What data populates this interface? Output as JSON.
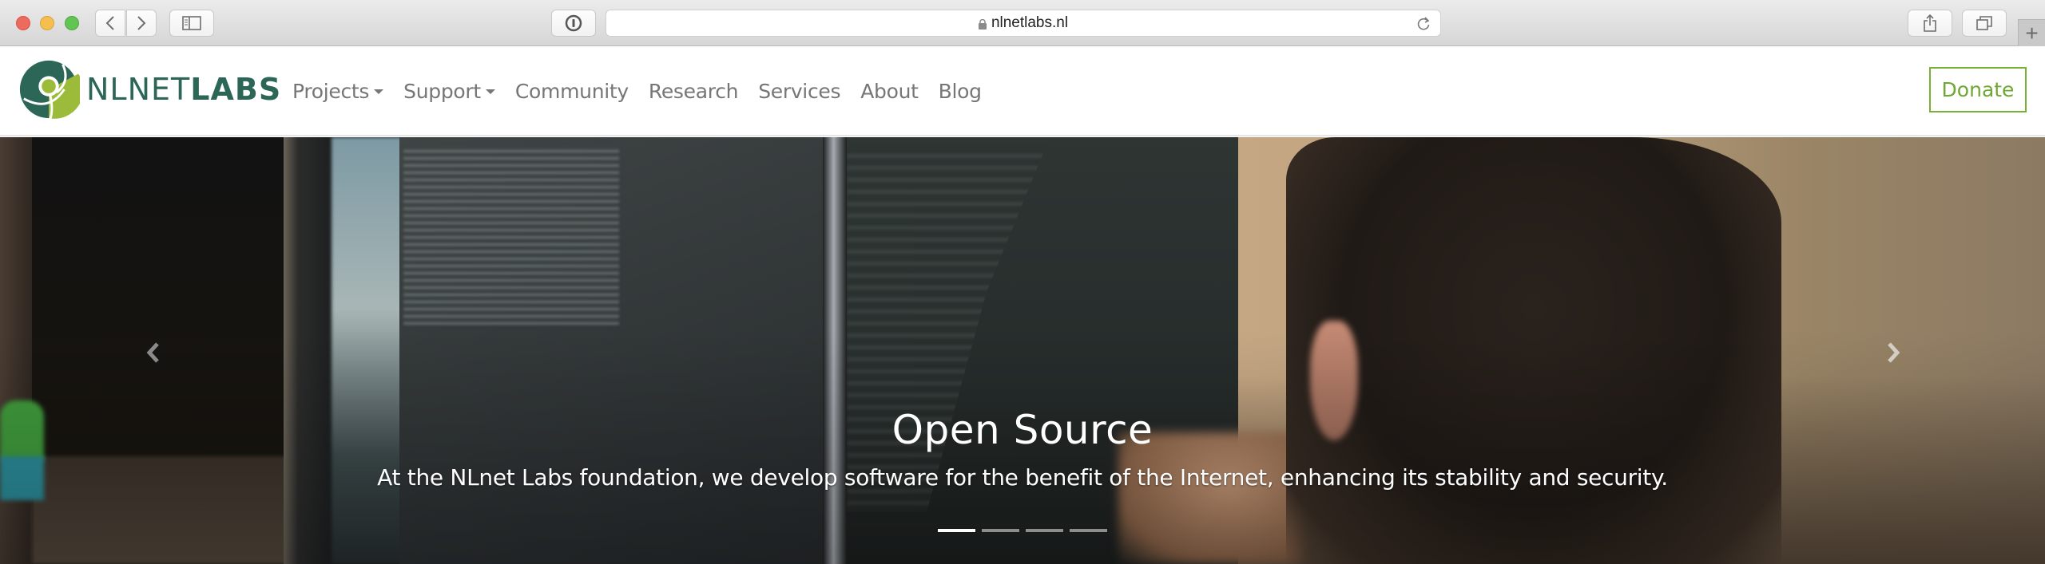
{
  "browser": {
    "url": "nlnetlabs.nl",
    "icons": {
      "close": "close-dot",
      "minimize": "minimize-dot",
      "zoom": "zoom-dot",
      "back": "chevron-left-icon",
      "forward": "chevron-right-icon",
      "sidebar": "sidebar-icon",
      "password": "password-icon",
      "lock": "lock-icon",
      "reload": "reload-icon",
      "share": "share-icon",
      "tabs": "tabs-icon",
      "new_tab": "+"
    }
  },
  "site": {
    "logo": {
      "text_light": "NLNET",
      "text_bold": "LABS",
      "color_dark": "#2b6657",
      "color_light": "#9cbb3b"
    },
    "nav": [
      {
        "label": "Projects",
        "dropdown": true
      },
      {
        "label": "Support",
        "dropdown": true
      },
      {
        "label": "Community",
        "dropdown": false
      },
      {
        "label": "Research",
        "dropdown": false
      },
      {
        "label": "Services",
        "dropdown": false
      },
      {
        "label": "About",
        "dropdown": false
      },
      {
        "label": "Blog",
        "dropdown": false
      }
    ],
    "donate_label": "Donate",
    "accent_color": "#78b138",
    "nav_text_color": "#767676"
  },
  "hero": {
    "title": "Open Source",
    "text": "At the NLnet Labs foundation, we develop software for the benefit of the Internet, enhancing its stability and security.",
    "prev_icon": "chevron-left-icon",
    "next_icon": "chevron-right-icon",
    "slide_count": 4,
    "active_slide": 1
  }
}
